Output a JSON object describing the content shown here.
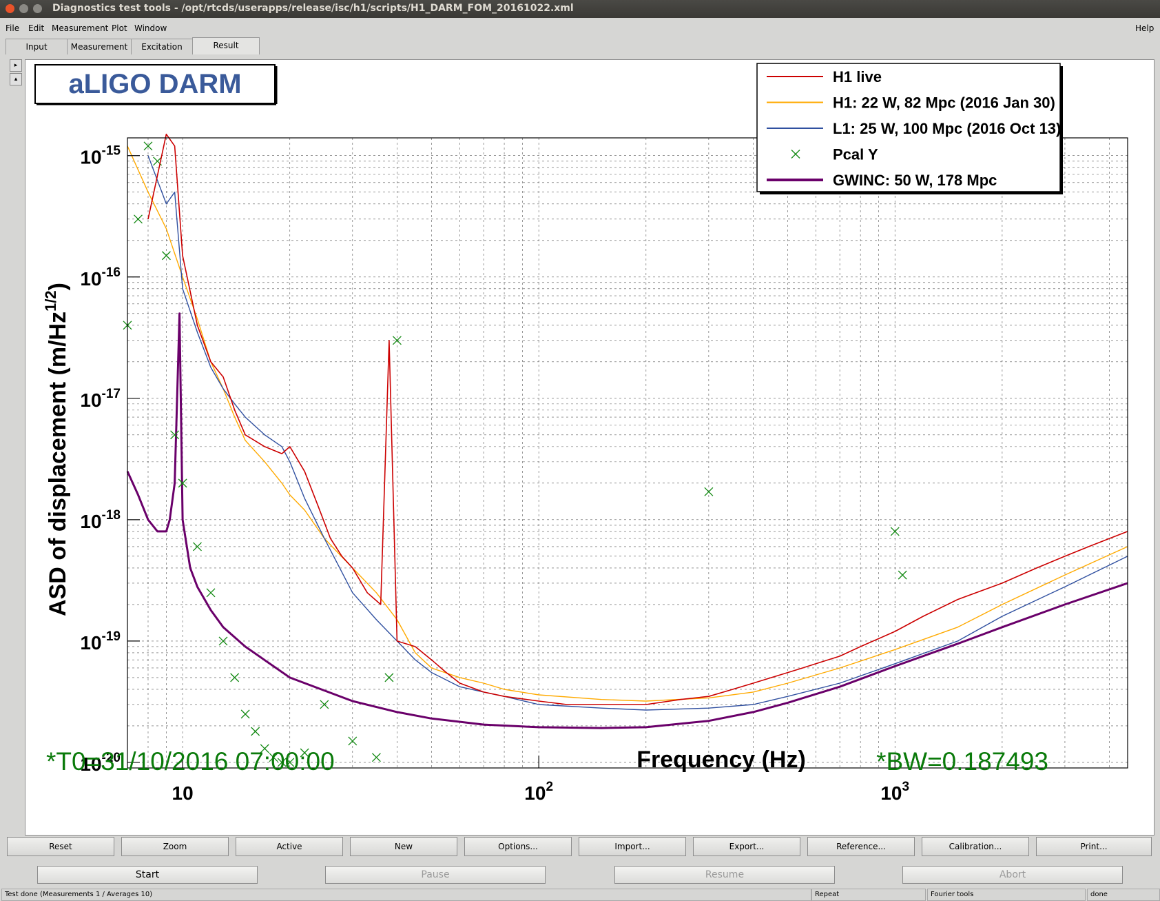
{
  "window": {
    "title": "Diagnostics test tools - /opt/rtcds/userapps/release/isc/h1/scripts/H1_DARM_FOM_20161022.xml"
  },
  "menu": {
    "file": "File",
    "edit": "Edit",
    "measurement": "Measurement",
    "plot": "Plot",
    "window": "Window",
    "help": "Help"
  },
  "tabs": [
    "Input",
    "Measurement",
    "Excitation",
    "Result"
  ],
  "plot": {
    "title_box": "aLIGO DARM",
    "t0_label": "*T0=31/10/2016 07:00:00",
    "bw_label": "*BW=0.187493",
    "colors": {
      "h1_live": "#cc0000",
      "h1_old": "#ffaa00",
      "l1": "#3050a0",
      "pcal": "#118811",
      "gwinc": "#6a006a",
      "annot_green": "#0a7a0a",
      "title_blue": "#3a5a9a"
    }
  },
  "chart_data": {
    "type": "line",
    "xscale": "log",
    "yscale": "log",
    "xlabel": "Frequency (Hz)",
    "ylabel": "ASD of displacement (m/Hz^1/2)",
    "xlim": [
      7,
      4500
    ],
    "ylim": [
      9e-21,
      1.4e-15
    ],
    "x_ticks": [
      {
        "value": 10,
        "base": "10",
        "exp": ""
      },
      {
        "value": 100,
        "base": "10",
        "exp": "2"
      },
      {
        "value": 1000,
        "base": "10",
        "exp": "3"
      }
    ],
    "y_ticks": [
      {
        "value": 1e-20,
        "base": "10",
        "exp": "-20"
      },
      {
        "value": 1e-19,
        "base": "10",
        "exp": "-19"
      },
      {
        "value": 1e-18,
        "base": "10",
        "exp": "-18"
      },
      {
        "value": 1e-17,
        "base": "10",
        "exp": "-17"
      },
      {
        "value": 1e-16,
        "base": "10",
        "exp": "-16"
      },
      {
        "value": 1e-15,
        "base": "10",
        "exp": "-15"
      }
    ],
    "grid": true,
    "legend_position": "top-right",
    "series": [
      {
        "name": "H1 live",
        "style": "line",
        "color": "#cc0000",
        "x": [
          8,
          9,
          9.5,
          10,
          11,
          12,
          13,
          14,
          15,
          17,
          19,
          20,
          22,
          24,
          26,
          28,
          30,
          33,
          36,
          38,
          40,
          45,
          50,
          55,
          60,
          70,
          80,
          100,
          120,
          150,
          200,
          250,
          300,
          350,
          400,
          450,
          500,
          550,
          600,
          700,
          800,
          1000,
          1200,
          1500,
          2000,
          2500,
          3000,
          3500,
          4000,
          4500
        ],
        "y": [
          3e-16,
          1.5e-15,
          1.2e-15,
          1.5e-16,
          4e-17,
          2e-17,
          1.5e-17,
          8e-18,
          5e-18,
          4e-18,
          3.5e-18,
          4e-18,
          2.5e-18,
          1.3e-18,
          7e-19,
          5e-19,
          4e-19,
          2.5e-19,
          2e-19,
          3e-17,
          1e-19,
          9e-20,
          7e-20,
          5.5e-20,
          4.5e-20,
          3.8e-20,
          3.5e-20,
          3.2e-20,
          3e-20,
          3e-20,
          3e-20,
          3.3e-20,
          3.5e-20,
          4e-20,
          4.5e-20,
          5e-20,
          5.5e-20,
          6e-20,
          6.5e-20,
          7.5e-20,
          9e-20,
          1.2e-19,
          1.6e-19,
          2.2e-19,
          3e-19,
          4e-19,
          5e-19,
          6e-19,
          7e-19,
          8e-19
        ]
      },
      {
        "name": "H1: 22 W, 82 Mpc (2016 Jan 30)",
        "style": "line",
        "color": "#ffaa00",
        "x": [
          7,
          8,
          9,
          10,
          11,
          12,
          13,
          14,
          15,
          17,
          19,
          20,
          22,
          25,
          30,
          35,
          40,
          45,
          50,
          60,
          70,
          80,
          100,
          150,
          200,
          300,
          400,
          500,
          700,
          1000,
          1500,
          2000,
          3000,
          4500
        ],
        "y": [
          1.2e-15,
          5e-16,
          2.5e-16,
          1e-16,
          4.5e-17,
          2e-17,
          1.2e-17,
          7e-18,
          4.5e-18,
          3e-18,
          2e-18,
          1.6e-18,
          1.2e-18,
          7e-19,
          4e-19,
          2.5e-19,
          1.5e-19,
          8e-20,
          6e-20,
          5e-20,
          4.5e-20,
          4e-20,
          3.6e-20,
          3.3e-20,
          3.2e-20,
          3.4e-20,
          3.8e-20,
          4.5e-20,
          6e-20,
          8.5e-20,
          1.3e-19,
          2e-19,
          3.5e-19,
          6e-19
        ]
      },
      {
        "name": "L1: 25 W, 100 Mpc (2016 Oct 13)",
        "style": "line",
        "color": "#3050a0",
        "x": [
          8,
          9,
          9.5,
          10,
          11,
          12,
          13,
          14,
          15,
          17,
          19,
          20,
          22,
          25,
          30,
          35,
          40,
          45,
          50,
          60,
          70,
          80,
          100,
          150,
          200,
          300,
          400,
          500,
          700,
          1000,
          1500,
          2000,
          3000,
          4500
        ],
        "y": [
          1e-15,
          4e-16,
          5e-16,
          8e-17,
          3.5e-17,
          1.8e-17,
          1.2e-17,
          9e-18,
          7e-18,
          5e-18,
          4e-18,
          3e-18,
          1.5e-18,
          7e-19,
          2.5e-19,
          1.5e-19,
          1e-19,
          7e-20,
          5.5e-20,
          4.2e-20,
          3.8e-20,
          3.5e-20,
          3e-20,
          2.8e-20,
          2.7e-20,
          2.8e-20,
          3e-20,
          3.5e-20,
          4.5e-20,
          6.5e-20,
          1e-19,
          1.6e-19,
          2.8e-19,
          5e-19
        ]
      },
      {
        "name": "Pcal Y",
        "style": "markers",
        "color": "#118811",
        "x": [
          7,
          7.5,
          8,
          8.5,
          9,
          9.5,
          10,
          11,
          12,
          13,
          14,
          15,
          16,
          17,
          18,
          19,
          20,
          22,
          25,
          30,
          35,
          38,
          40,
          300,
          1000,
          1050
        ],
        "y": [
          4e-17,
          3e-16,
          1.2e-15,
          9e-16,
          1.5e-16,
          5e-18,
          2e-18,
          6e-19,
          2.5e-19,
          1e-19,
          5e-20,
          2.5e-20,
          1.8e-20,
          1.3e-20,
          1.1e-20,
          1e-20,
          1e-20,
          1.2e-20,
          3e-20,
          1.5e-20,
          1.1e-20,
          5e-20,
          3e-17,
          1.7e-18,
          8e-19,
          3.5e-19
        ]
      },
      {
        "name": "GWINC: 50 W, 178 Mpc",
        "style": "line",
        "color": "#6a006a",
        "x": [
          7,
          7.5,
          8,
          8.5,
          9,
          9.2,
          9.5,
          9.8,
          10,
          10.5,
          11,
          12,
          13,
          15,
          20,
          30,
          40,
          50,
          70,
          100,
          150,
          200,
          300,
          400,
          500,
          700,
          1000,
          1500,
          2000,
          3000,
          4500
        ],
        "y": [
          2.5e-18,
          1.6e-18,
          1e-18,
          8e-19,
          8e-19,
          1e-18,
          2e-18,
          5e-17,
          1e-18,
          4e-19,
          2.8e-19,
          1.8e-19,
          1.3e-19,
          9e-20,
          5e-20,
          3.2e-20,
          2.6e-20,
          2.3e-20,
          2.05e-20,
          1.95e-20,
          1.92e-20,
          1.95e-20,
          2.2e-20,
          2.6e-20,
          3.1e-20,
          4.2e-20,
          6.2e-20,
          9.5e-20,
          1.3e-19,
          2e-19,
          3e-19
        ]
      }
    ]
  },
  "buttons": [
    "Reset",
    "Zoom",
    "Active",
    "New",
    "Options...",
    "Import...",
    "Export...",
    "Reference...",
    "Calibration...",
    "Print..."
  ],
  "controls": {
    "start": "Start",
    "pause": "Pause",
    "resume": "Resume",
    "abort": "Abort"
  },
  "status": {
    "message": "Test done (Measurements 1 / Averages 10)",
    "repeat": "Repeat",
    "mode": "Fourier tools",
    "state": "done"
  }
}
